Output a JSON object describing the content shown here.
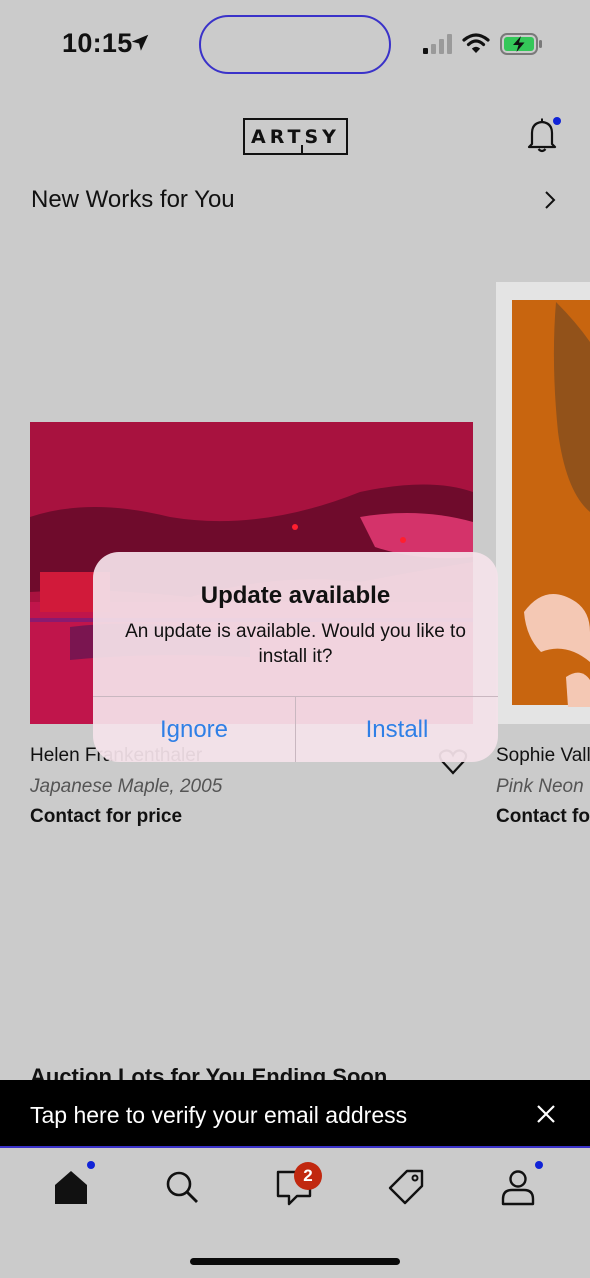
{
  "status_bar": {
    "time": "10:15",
    "location_icon": "location-arrow-icon",
    "signal_icon": "cellular-signal-icon",
    "wifi_icon": "wifi-icon",
    "battery_icon": "battery-charging-icon",
    "battery_color": "#34c759"
  },
  "header": {
    "logo_text": "ARTSY",
    "notification_icon": "bell-icon",
    "has_unread": true,
    "dot_color": "#1023d7"
  },
  "section": {
    "title": "New Works for You",
    "chevron_icon": "chevron-right-icon"
  },
  "artworks": [
    {
      "artist": "Helen Frankenthaler",
      "title": "Japanese Maple, 2005",
      "price": "Contact for price",
      "save_icon": "heart-icon"
    },
    {
      "artist": "Sophie Vall",
      "title": "Pink Neon",
      "price": "Contact for"
    }
  ],
  "next_section": {
    "title": "Auction Lots for You Ending Soon"
  },
  "banner": {
    "text": "Tap here to verify your email address",
    "close_icon": "close-icon"
  },
  "tabs": [
    {
      "name": "home",
      "icon": "home-icon",
      "has_dot": true
    },
    {
      "name": "search",
      "icon": "search-icon",
      "has_dot": false
    },
    {
      "name": "inbox",
      "icon": "inbox-icon",
      "badge": "2"
    },
    {
      "name": "sell",
      "icon": "tag-icon",
      "has_dot": false
    },
    {
      "name": "profile",
      "icon": "profile-icon",
      "has_dot": true
    }
  ],
  "dialog": {
    "title": "Update available",
    "message": "An update is available. Would you like to install it?",
    "ignore_label": "Ignore",
    "install_label": "Install",
    "button_color": "#2f7fe6"
  }
}
